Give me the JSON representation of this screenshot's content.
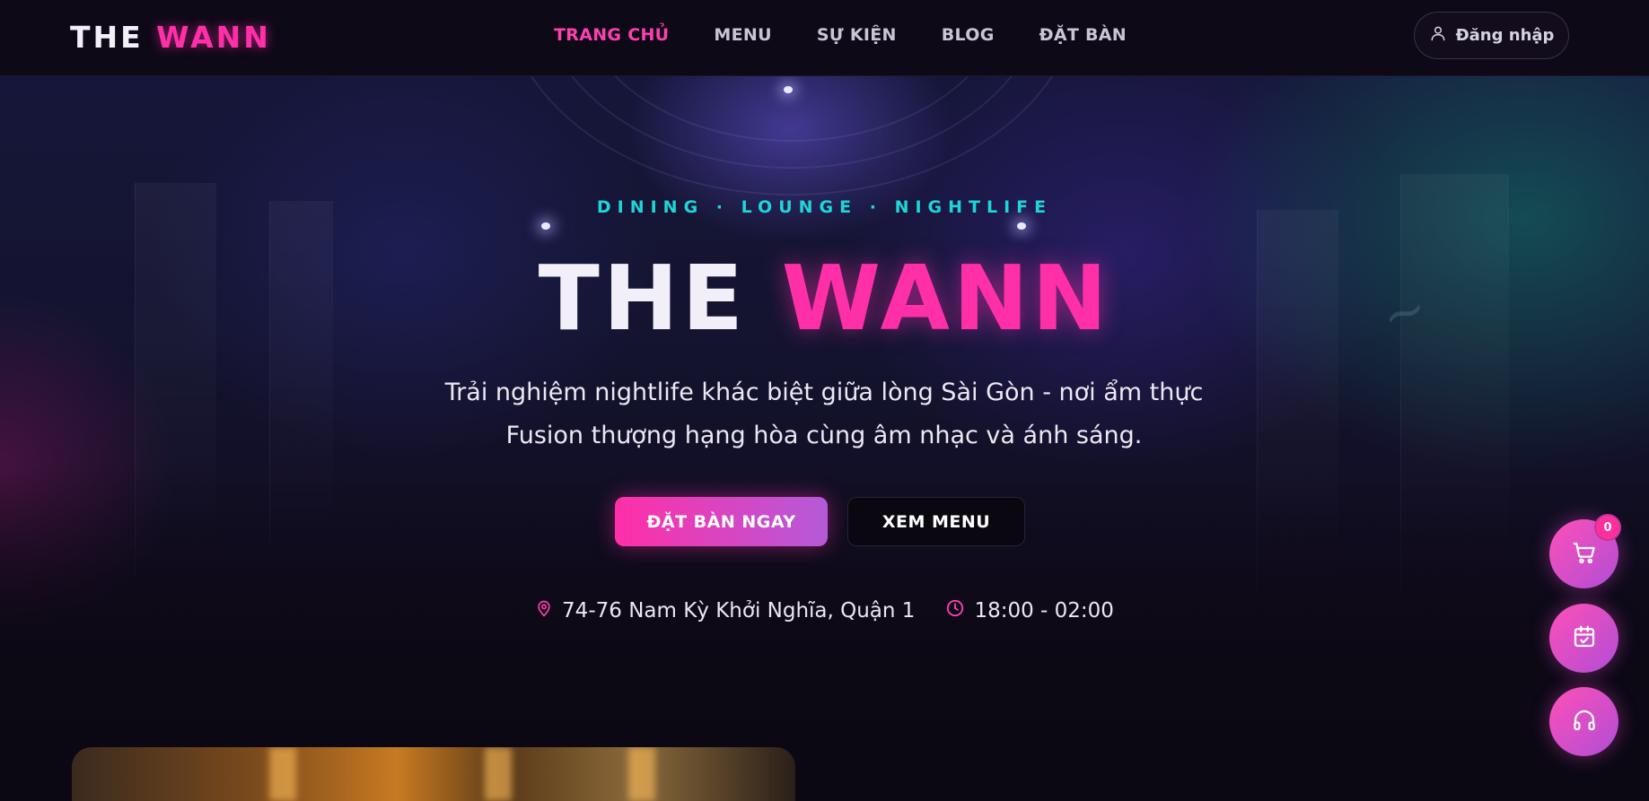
{
  "header": {
    "logo_part1": "THE",
    "logo_part2": "WANN",
    "nav": [
      {
        "label": "TRANG CHỦ",
        "active": true
      },
      {
        "label": "MENU",
        "active": false
      },
      {
        "label": "SỰ KIỆN",
        "active": false
      },
      {
        "label": "BLOG",
        "active": false
      },
      {
        "label": "ĐẶT BÀN",
        "active": false
      }
    ],
    "login_label": "Đăng nhập"
  },
  "hero": {
    "tagline": "DINING · LOUNGE · NIGHTLIFE",
    "title_part1": "THE",
    "title_part2": "WANN",
    "description_line1": "Trải nghiệm nightlife khác biệt giữa lòng Sài Gòn - nơi ẩm thực",
    "description_line2": "Fusion thượng hạng hòa cùng âm nhạc và ánh sáng.",
    "primary_button": "ĐẶT BÀN NGAY",
    "secondary_button": "XEM MENU",
    "address": "74-76 Nam Kỳ Khởi Nghĩa, Quận 1",
    "hours": "18:00 - 02:00"
  },
  "floating": {
    "cart_count": "0",
    "icons": [
      "cart-icon",
      "calendar-check-icon",
      "headset-icon"
    ]
  },
  "colors": {
    "accent_pink": "#ff2fa8",
    "accent_cyan": "#1ed5d8",
    "background": "#0c0813"
  }
}
